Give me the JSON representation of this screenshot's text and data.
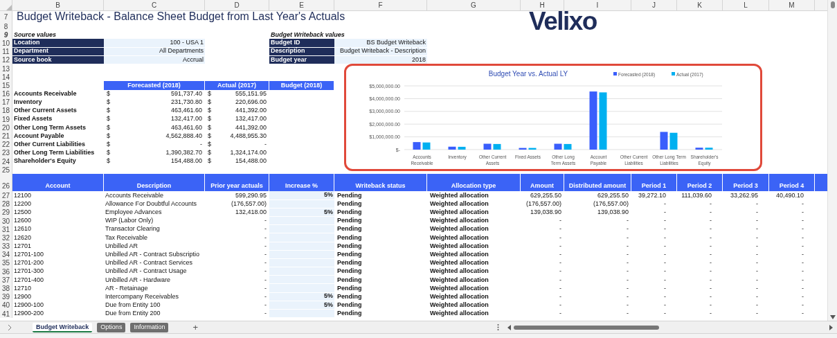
{
  "column_headers": [
    "B",
    "C",
    "D",
    "E",
    "F",
    "G",
    "H",
    "I",
    "J",
    "K",
    "L",
    "M"
  ],
  "logo": "Velixo",
  "top_rows": [
    {
      "kind": "title",
      "num": "7",
      "text": "Budget Writeback - Balance Sheet Budget from Last Year's Actuals"
    },
    {
      "kind": "blank",
      "num": "8"
    },
    {
      "kind": "headings",
      "num": "9",
      "left": "Source values",
      "right": "Budget Writeback values"
    },
    {
      "kind": "field",
      "num": "10",
      "label": "Location",
      "value": "100 - USA 1",
      "label2": "Budget ID",
      "value2": "BS Budget Writeback"
    },
    {
      "kind": "field",
      "num": "11",
      "label": "Department",
      "value": "All Departments",
      "label2": "Description",
      "value2": "Budget Writeback - Description"
    },
    {
      "kind": "field",
      "num": "12",
      "label": "Source book",
      "value": "Accrual",
      "label2": "Budget year",
      "value2": "2018"
    },
    {
      "kind": "blank",
      "num": "13"
    },
    {
      "kind": "blank",
      "num": "14"
    },
    {
      "kind": "summary_header",
      "num": "15",
      "columns": [
        "Forecasted (2018)",
        "Actual (2017)",
        "Budget (2018)"
      ]
    },
    {
      "kind": "summary",
      "num": "16",
      "label": "Accounts Receivable",
      "cells": [
        "$",
        "591,737.40",
        "$",
        "555,151.95"
      ]
    },
    {
      "kind": "summary",
      "num": "17",
      "label": "Inventory",
      "cells": [
        "$",
        "231,730.80",
        "$",
        "220,696.00"
      ]
    },
    {
      "kind": "summary",
      "num": "18",
      "label": "Other Current Assets",
      "cells": [
        "$",
        "463,461.60",
        "$",
        "441,392.00"
      ]
    },
    {
      "kind": "summary",
      "num": "19",
      "label": "Fixed Assets",
      "cells": [
        "$",
        "132,417.00",
        "$",
        "132,417.00"
      ]
    },
    {
      "kind": "summary",
      "num": "20",
      "label": "Other Long Term Assets",
      "cells": [
        "$",
        "463,461.60",
        "$",
        "441,392.00"
      ]
    },
    {
      "kind": "summary",
      "num": "21",
      "label": "Account Payable",
      "cells": [
        "$",
        "4,562,888.40",
        "$",
        "4,488,955.30"
      ]
    },
    {
      "kind": "summary",
      "num": "22",
      "label": "Other Current Liabilities",
      "cells": [
        "$",
        "-",
        "$",
        "-"
      ]
    },
    {
      "kind": "summary",
      "num": "23",
      "label": "Other Long Term Liabilities",
      "cells": [
        "$",
        "1,390,382.70",
        "$",
        "1,324,174.00"
      ]
    },
    {
      "kind": "summary",
      "num": "24",
      "label": "Shareholder's Equity",
      "cells": [
        "$",
        "154,488.00",
        "$",
        "154,488.00"
      ]
    },
    {
      "kind": "blank",
      "num": "25"
    }
  ],
  "chart": {
    "chart_data": {
      "type": "bar",
      "title": "Budget Year vs. Actual LY",
      "categories": [
        "Accounts Receivable",
        "Inventory",
        "Other Current Assets",
        "Fixed Assets",
        "Other Long Term Assets",
        "Account Payable",
        "Other Current Liabilities",
        "Other Long Term Liabilities",
        "Shareholder's Equity"
      ],
      "series": [
        {
          "name": "Forecasted (2018)",
          "color": "#3a5efc",
          "values": [
            590000,
            230000,
            460000,
            130000,
            460000,
            4560000,
            0,
            1390000,
            150000
          ]
        },
        {
          "name": "Actual (2017)",
          "color": "#00b0f0",
          "values": [
            560000,
            220000,
            440000,
            130000,
            440000,
            4490000,
            0,
            1320000,
            150000
          ]
        }
      ],
      "grid": true,
      "legend": true,
      "ylim": [
        0,
        5000000
      ],
      "yticks": [
        {
          "value": 0,
          "label": "$-"
        },
        {
          "value": 1000000,
          "label": "$1,000,000.00"
        },
        {
          "value": 2000000,
          "label": "$2,000,000.00"
        },
        {
          "value": 3000000,
          "label": "$3,000,000.00"
        },
        {
          "value": 4000000,
          "label": "$4,000,000.00"
        },
        {
          "value": 5000000,
          "label": "$5,000,000.00"
        }
      ]
    }
  },
  "table": {
    "header_num": "26",
    "columns": [
      "Account",
      "Description",
      "Prior year actuals",
      "Increase %",
      "Writeback status",
      "Allocation type",
      "Amount",
      "Distributed amount",
      "Period 1",
      "Period 2",
      "Period 3",
      "Period 4"
    ],
    "rows": [
      {
        "num": "27",
        "account": "12100",
        "description": "Accounts Receivable",
        "prior": "599,290.95",
        "increase": "5%",
        "status": "Pending",
        "allocation": "Weighted allocation",
        "amounts": [
          "629,255.50",
          "629,255.50",
          "39,272.10",
          "111,039.60",
          "33,262.95",
          "40,490.10"
        ]
      },
      {
        "num": "28",
        "account": "12200",
        "description": "Allowance For Doubtful Accounts",
        "prior": "(176,557.00)",
        "status": "Pending",
        "allocation": "Weighted allocation",
        "amounts": [
          "(176,557.00)",
          "(176,557.00)",
          "-",
          "-",
          "-",
          "-"
        ]
      },
      {
        "num": "29",
        "account": "12500",
        "description": "Employee Advances",
        "prior": "132,418.00",
        "increase": "5%",
        "status": "Pending",
        "allocation": "Weighted allocation",
        "amounts": [
          "139,038.90",
          "139,038.90",
          "-",
          "-",
          "-",
          "-"
        ]
      },
      {
        "num": "30",
        "account": "12600",
        "description": "WIP (Labor Only)",
        "prior": "-",
        "status": "Pending",
        "allocation": "Weighted allocation",
        "amounts": [
          "-",
          "-",
          "-",
          "-",
          "-",
          "-"
        ]
      },
      {
        "num": "31",
        "account": "12610",
        "description": "Transactor Clearing",
        "prior": "-",
        "status": "Pending",
        "allocation": "Weighted allocation",
        "amounts": [
          "-",
          "-",
          "-",
          "-",
          "-",
          "-"
        ]
      },
      {
        "num": "32",
        "account": "12620",
        "description": "Tax Receivable",
        "prior": "-",
        "status": "Pending",
        "allocation": "Weighted allocation",
        "amounts": [
          "-",
          "-",
          "-",
          "-",
          "-",
          "-"
        ]
      },
      {
        "num": "33",
        "account": "12701",
        "description": "Unbilled AR",
        "prior": "-",
        "status": "Pending",
        "allocation": "Weighted allocation",
        "amounts": [
          "-",
          "-",
          "-",
          "-",
          "-",
          "-"
        ]
      },
      {
        "num": "34",
        "account": "12701-100",
        "description": "Unbilled AR - Contract Subscriptio",
        "prior": "-",
        "status": "Pending",
        "allocation": "Weighted allocation",
        "amounts": [
          "-",
          "-",
          "-",
          "-",
          "-",
          "-"
        ]
      },
      {
        "num": "35",
        "account": "12701-200",
        "description": "Unbilled AR - Contract Services",
        "prior": "-",
        "status": "Pending",
        "allocation": "Weighted allocation",
        "amounts": [
          "-",
          "-",
          "-",
          "-",
          "-",
          "-"
        ]
      },
      {
        "num": "36",
        "account": "12701-300",
        "description": "Unbilled AR - Contract Usage",
        "prior": "-",
        "status": "Pending",
        "allocation": "Weighted allocation",
        "amounts": [
          "-",
          "-",
          "-",
          "-",
          "-",
          "-"
        ]
      },
      {
        "num": "37",
        "account": "12701-400",
        "description": "Unbilled AR - Hardware",
        "prior": "-",
        "status": "Pending",
        "allocation": "Weighted allocation",
        "amounts": [
          "-",
          "-",
          "-",
          "-",
          "-",
          "-"
        ]
      },
      {
        "num": "38",
        "account": "12710",
        "description": "AR - Retainage",
        "prior": "-",
        "status": "Pending",
        "allocation": "Weighted allocation",
        "amounts": [
          "-",
          "-",
          "-",
          "-",
          "-",
          "-"
        ]
      },
      {
        "num": "39",
        "account": "12900",
        "description": "Intercompany Receivables",
        "prior": "-",
        "increase": "5%",
        "status": "Pending",
        "allocation": "Weighted allocation",
        "amounts": [
          "-",
          "-",
          "-",
          "-",
          "-",
          "-"
        ]
      },
      {
        "num": "40",
        "account": "12900-100",
        "description": "Due from Entity 100",
        "prior": "-",
        "increase": "5%",
        "status": "Pending",
        "allocation": "Weighted allocation",
        "amounts": [
          "-",
          "-",
          "-",
          "-",
          "-",
          "-"
        ]
      },
      {
        "num": "41",
        "account": "12900-200",
        "description": "Due from Entity 200",
        "prior": "-",
        "status": "Pending",
        "allocation": "Weighted allocation",
        "amounts": [
          "-",
          "-",
          "-",
          "-",
          "-",
          "-"
        ]
      }
    ]
  },
  "sheet_tabs": [
    {
      "label": "Budget Writeback",
      "selected": true
    },
    {
      "label": "Options",
      "selected": false
    },
    {
      "label": "Information",
      "selected": false
    }
  ],
  "add_sheet": "+"
}
